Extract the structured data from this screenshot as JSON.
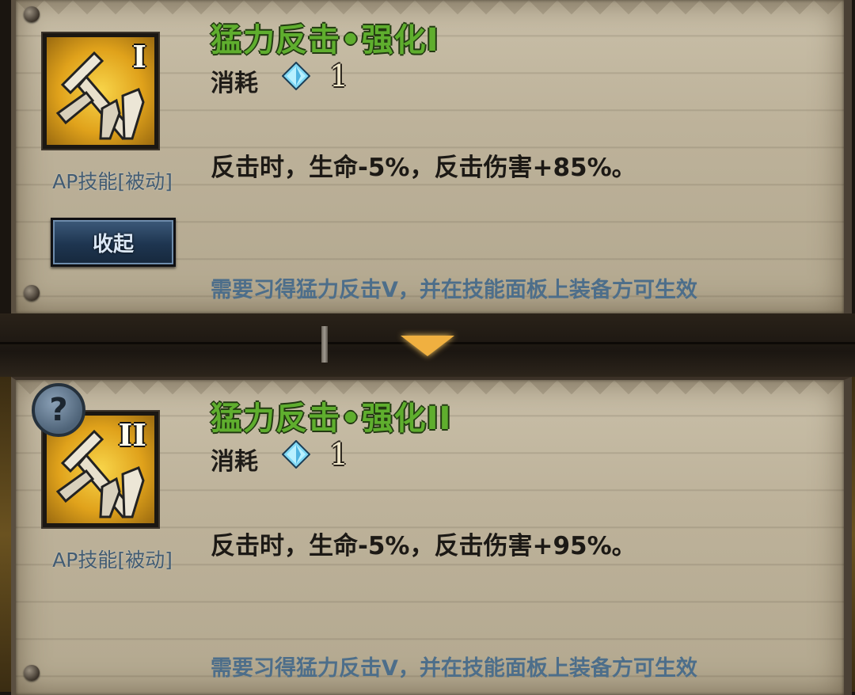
{
  "skills": [
    {
      "title": "猛力反击•强化Ⅰ",
      "roman": "I",
      "cost_label": "消耗",
      "cost_value": "1",
      "type_label": "AP技能[被动]",
      "description": "反击时，生命-5%，反击伤害+85%。",
      "requirement": "需要习得猛力反击V，并在技能面板上装备方可生效",
      "button_label": "收起"
    },
    {
      "title": "猛力反击•强化ⅠⅠ",
      "roman": "II",
      "cost_label": "消耗",
      "cost_value": "1",
      "type_label": "AP技能[被动]",
      "description": "反击时，生命-5%，反击伤害+95%。",
      "requirement": "需要习得猛力反击V，并在技能面板上装备方可生效",
      "help_symbol": "?"
    }
  ],
  "icons": {
    "skill": "broken-sword-icon",
    "gem": "diamond-gem-icon",
    "divider": "chevron-down-icon",
    "help": "question-icon"
  },
  "colors": {
    "title_green": "#5fae2e",
    "requirement_blue": "#4d6e8a",
    "icon_gold": "#e0a21b",
    "arrow_orange": "#f0b040"
  }
}
